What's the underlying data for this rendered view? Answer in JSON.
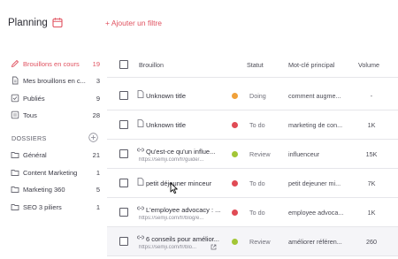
{
  "header": {
    "title": "Planning",
    "add_filter": "+ Ajouter un filtre"
  },
  "colors": {
    "accent": "#e0515f",
    "status_doing": "#f0a13a",
    "status_todo": "#e04b55",
    "status_review": "#a3c636"
  },
  "sidebar": {
    "items": [
      {
        "label": "Brouillons en cours",
        "count": "19",
        "icon": "pencil-icon",
        "active": true
      },
      {
        "label": "Mes brouillons en c...",
        "count": "3",
        "icon": "document-icon"
      },
      {
        "label": "Publiés",
        "count": "9",
        "icon": "check-square-icon"
      },
      {
        "label": "Tous",
        "count": "28",
        "icon": "list-icon"
      }
    ],
    "folders_title": "DOSSIERS",
    "folders": [
      {
        "label": "Général",
        "count": "21"
      },
      {
        "label": "Content Marketing",
        "count": "1"
      },
      {
        "label": "Marketing 360",
        "count": "5"
      },
      {
        "label": "SEO 3 piliers",
        "count": "1"
      }
    ]
  },
  "table": {
    "columns": {
      "title": "Brouillon",
      "status": "Statut",
      "keyword": "Mot-clé principal",
      "volume": "Volume"
    },
    "rows": [
      {
        "title": "Unknown title",
        "url": "",
        "status": "Doing",
        "keyword": "comment augme...",
        "volume": "-",
        "icon": "document-icon"
      },
      {
        "title": "Unknown title",
        "url": "",
        "status": "To do",
        "keyword": "marketing de con...",
        "volume": "1K",
        "icon": "document-icon"
      },
      {
        "title": "Qu'est-ce qu'un influe...",
        "url": "https://semji.com/fr/guide/...",
        "status": "Review",
        "keyword": "influenceur",
        "volume": "15K",
        "icon": "link-icon"
      },
      {
        "title": "petit déjeuner minceur",
        "url": "",
        "status": "To do",
        "keyword": "petit dejeuner mi...",
        "volume": "7K",
        "icon": "document-icon"
      },
      {
        "title": "L'employee advocacy : ...",
        "url": "https://semji.com/fr/blog/e...",
        "status": "To do",
        "keyword": "employee advoca...",
        "volume": "1K",
        "icon": "link-icon"
      },
      {
        "title": "6 conseils pour amélior...",
        "url": "https://semji.com/fr/blo...",
        "status": "Review",
        "keyword": "améliorer référen...",
        "volume": "260",
        "icon": "link-icon"
      }
    ]
  }
}
